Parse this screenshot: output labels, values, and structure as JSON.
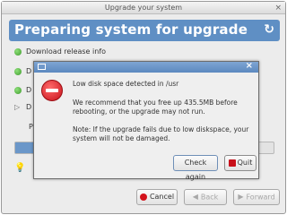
{
  "window": {
    "title": "Upgrade your system",
    "close_glyph": "×"
  },
  "header": {
    "title": "Preparing system for upgrade",
    "refresh_icon": "refresh-icon"
  },
  "steps": [
    {
      "label": "Download release info"
    },
    {
      "label": "D"
    },
    {
      "label": "D"
    },
    {
      "label": "D"
    },
    {
      "label": "P"
    }
  ],
  "progress": {
    "fraction": 0.08
  },
  "buttons": {
    "cancel": "Cancel",
    "back": "Back",
    "forward": "Forward"
  },
  "dialog": {
    "message_title": "Low disk space detected in /usr",
    "message_body": "We recommend that you free up 435.5MB before rebooting, or the upgrade may not run.",
    "message_note": "Note: If the upgrade fails due to low diskspace, your system will not be damaged.",
    "check_again": "Check again",
    "quit": "Quit",
    "close_glyph": "×"
  },
  "colors": {
    "accent": "#5f8fc4",
    "error": "#d3121c",
    "step_ok": "#3e9a2c"
  }
}
